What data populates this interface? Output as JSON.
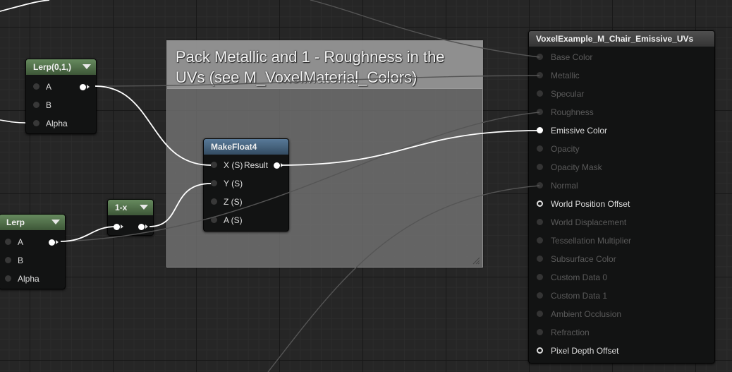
{
  "comment": {
    "title": "Pack Metallic and 1 - Roughness in the UVs (see M_VoxelMaterial_Colors)"
  },
  "nodes": {
    "lerp_top": {
      "title": "Lerp(0,1,)",
      "inputs": [
        "A",
        "B",
        "Alpha"
      ]
    },
    "lerp_bottom": {
      "title": "Lerp",
      "inputs": [
        "A",
        "B",
        "Alpha"
      ]
    },
    "one_minus": {
      "title": "1-x"
    },
    "make_float4": {
      "title": "MakeFloat4",
      "inputs": [
        "X (S)",
        "Y (S)",
        "Z (S)",
        "A (S)"
      ],
      "output": "Result"
    },
    "material_result": {
      "title": "VoxelExample_M_Chair_Emissive_UVs",
      "inputs": [
        {
          "label": "Base Color",
          "active": false
        },
        {
          "label": "Metallic",
          "active": false
        },
        {
          "label": "Specular",
          "active": false
        },
        {
          "label": "Roughness",
          "active": false
        },
        {
          "label": "Emissive Color",
          "active": true
        },
        {
          "label": "Opacity",
          "active": false
        },
        {
          "label": "Opacity Mask",
          "active": false
        },
        {
          "label": "Normal",
          "active": false
        },
        {
          "label": "World Position Offset",
          "active": true
        },
        {
          "label": "World Displacement",
          "active": false
        },
        {
          "label": "Tessellation Multiplier",
          "active": false
        },
        {
          "label": "Subsurface Color",
          "active": false
        },
        {
          "label": "Custom Data 0",
          "active": false
        },
        {
          "label": "Custom Data 1",
          "active": false
        },
        {
          "label": "Ambient Occlusion",
          "active": false
        },
        {
          "label": "Refraction",
          "active": false
        },
        {
          "label": "Pixel Depth Offset",
          "active": true
        }
      ]
    }
  },
  "colors": {
    "canvas": "#262626",
    "wire_active": "#ffffff",
    "wire_inactive": "#555555",
    "header_green": "#4f6e48",
    "header_blue": "#44627d"
  }
}
